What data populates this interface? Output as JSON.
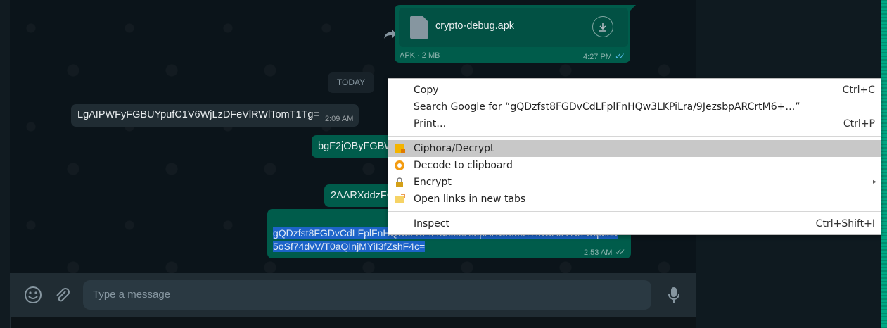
{
  "file_message": {
    "filename": "crypto-debug.apk",
    "meta": "APK · 2 MB",
    "time": "4:27 PM"
  },
  "date_chip": "TODAY",
  "messages": [
    {
      "text": "LgAIPWFyFGBUYpufC1V6WjLzDFeVlRWlTomT1Tg=",
      "time": "2:09 AM",
      "direction": "incoming"
    },
    {
      "text": "bgF2jOByFGBW",
      "direction": "outgoing"
    },
    {
      "text": "2AARXddzFG",
      "direction": "outgoing"
    },
    {
      "line1": "gQDzfst8FGDvCdLFplFnHQw3LKPiLra/9JezsbpARCrtM6+HKCA5YNrLwqMsa",
      "line2": "5oSf74dvV/T0aQInjMYiI3fZshF4c=",
      "time": "2:53 AM",
      "direction": "outgoing",
      "selected": true
    }
  ],
  "composer": {
    "placeholder": "Type a message"
  },
  "icons": {
    "emoji": "emoji-icon",
    "attach": "paperclip-icon",
    "mic": "microphone-icon",
    "forward": "forward-icon",
    "download": "download-icon",
    "file": "file-icon"
  },
  "context_menu": {
    "copy": {
      "label": "Copy",
      "shortcut": "Ctrl+C"
    },
    "search": {
      "label": "Search Google for “gQDzfst8FGDvCdLFplFnHQw3LKPiLra/9JezsbpARCrtM6+…”"
    },
    "print": {
      "label": "Print…",
      "shortcut": "Ctrl+P"
    },
    "ciphora": {
      "label": "Ciphora/Decrypt"
    },
    "decode": {
      "label": "Decode to clipboard"
    },
    "encrypt": {
      "label": "Encrypt"
    },
    "open_links": {
      "label": "Open links in new tabs"
    },
    "inspect": {
      "label": "Inspect",
      "shortcut": "Ctrl+Shift+I"
    }
  },
  "colors": {
    "outgoing_bubble": "#005c4b",
    "incoming_bubble": "#202c33",
    "selection": "#1d64c9",
    "menu_highlight": "#c8c8c8"
  }
}
